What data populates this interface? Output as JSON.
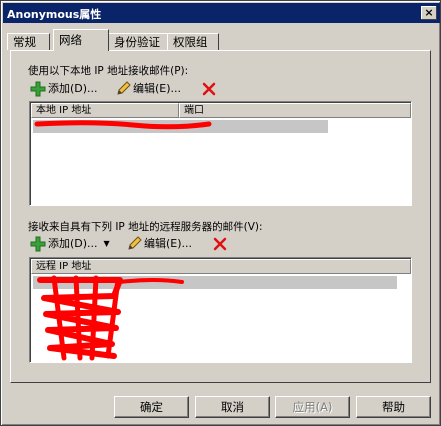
{
  "window": {
    "title": "Anonymous属性",
    "close_label": "×"
  },
  "tabs": [
    {
      "label": "常规",
      "active": false
    },
    {
      "label": "网络",
      "active": true
    },
    {
      "label": "身份验证",
      "active": false
    },
    {
      "label": "权限组",
      "active": false
    }
  ],
  "local_section": {
    "label": "使用以下本地 IP 地址接收邮件(P):",
    "add_label": "添加(D)...",
    "edit_label": "编辑(E)...",
    "columns": [
      "本地 IP 地址",
      "端口"
    ]
  },
  "remote_section": {
    "label": "接收来自具有下列 IP 地址的远程服务器的邮件(V):",
    "add_label": "添加(D)...",
    "edit_label": "编辑(E)...",
    "columns": [
      "远程 IP 地址"
    ]
  },
  "buttons": {
    "ok": "确定",
    "cancel": "取消",
    "apply": "应用(A)",
    "help": "帮助"
  },
  "colors": {
    "redaction": "#ff0000",
    "title_bar": "#0a246a",
    "face": "#d4d0c8"
  }
}
